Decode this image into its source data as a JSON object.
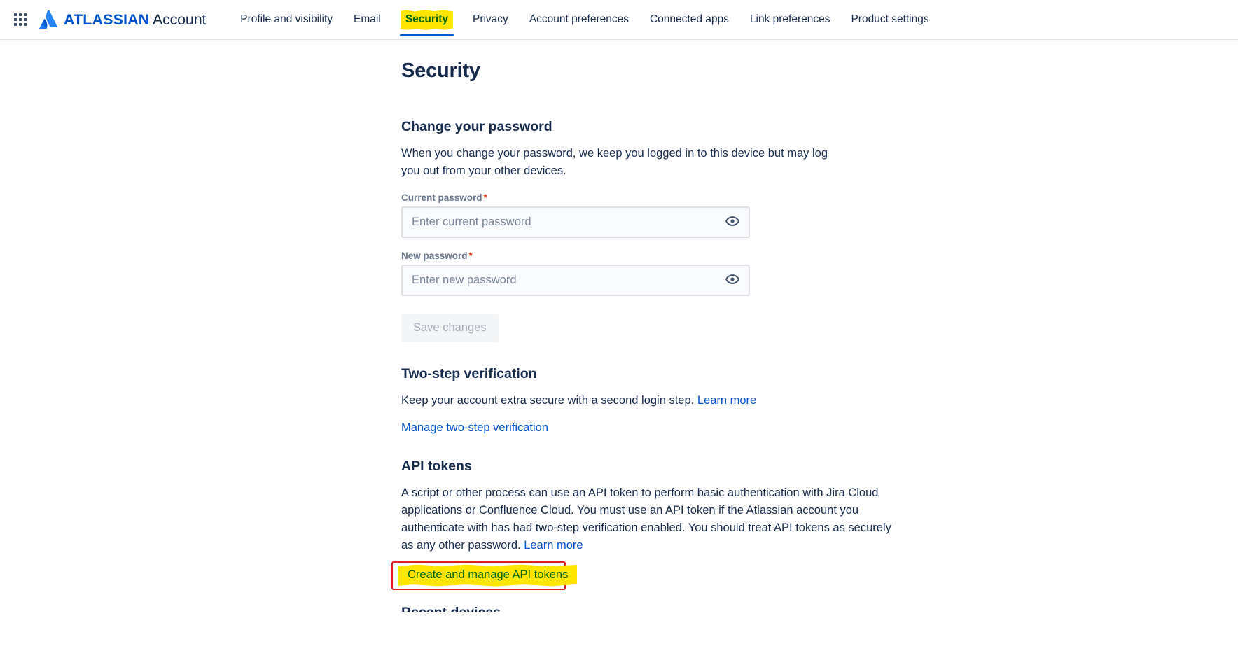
{
  "header": {
    "app_switcher_icon": "grid-apps-icon",
    "logo_icon": "atlassian-logo-icon",
    "brand_bold": "ATLASSIAN",
    "brand_regular": "Account",
    "nav_items": [
      {
        "label": "Profile and visibility",
        "selected": false,
        "highlighted": false
      },
      {
        "label": "Email",
        "selected": false,
        "highlighted": false
      },
      {
        "label": "Security",
        "selected": true,
        "highlighted": true
      },
      {
        "label": "Privacy",
        "selected": false,
        "highlighted": false
      },
      {
        "label": "Account preferences",
        "selected": false,
        "highlighted": false
      },
      {
        "label": "Connected apps",
        "selected": false,
        "highlighted": false
      },
      {
        "label": "Link preferences",
        "selected": false,
        "highlighted": false
      },
      {
        "label": "Product settings",
        "selected": false,
        "highlighted": false
      }
    ]
  },
  "page": {
    "title": "Security"
  },
  "password_section": {
    "title": "Change your password",
    "description": "When you change your password, we keep you logged in to this device but may log you out from your other devices.",
    "current_password": {
      "label": "Current password",
      "required_mark": "*",
      "placeholder": "Enter current password",
      "value": "",
      "reveal_icon": "eye-icon"
    },
    "new_password": {
      "label": "New password",
      "required_mark": "*",
      "placeholder": "Enter new password",
      "value": "",
      "reveal_icon": "eye-icon"
    },
    "save_label": "Save changes"
  },
  "two_step_section": {
    "title": "Two-step verification",
    "description": "Keep your account extra secure with a second login step.",
    "learn_more": "Learn more",
    "manage_link": "Manage two-step verification"
  },
  "api_tokens_section": {
    "title": "API tokens",
    "description": "A script or other process can use an API token to perform basic authentication with Jira Cloud applications or Confluence Cloud. You must use an API token if the Atlassian account you authenticate with has had two-step verification enabled. You should treat API tokens as securely as any other password.",
    "learn_more": "Learn more",
    "manage_link": "Create and manage API tokens"
  },
  "next_section": {
    "title": "Recent devices"
  },
  "colors": {
    "brand_blue": "#0052cc",
    "link_blue": "#0052cc",
    "text": "#172b4d",
    "label_gray": "#6b778c",
    "highlight_yellow": "#ffe500",
    "highlight_text_green": "#006611",
    "annotation_red": "#e02020",
    "required_red": "#de350b"
  }
}
